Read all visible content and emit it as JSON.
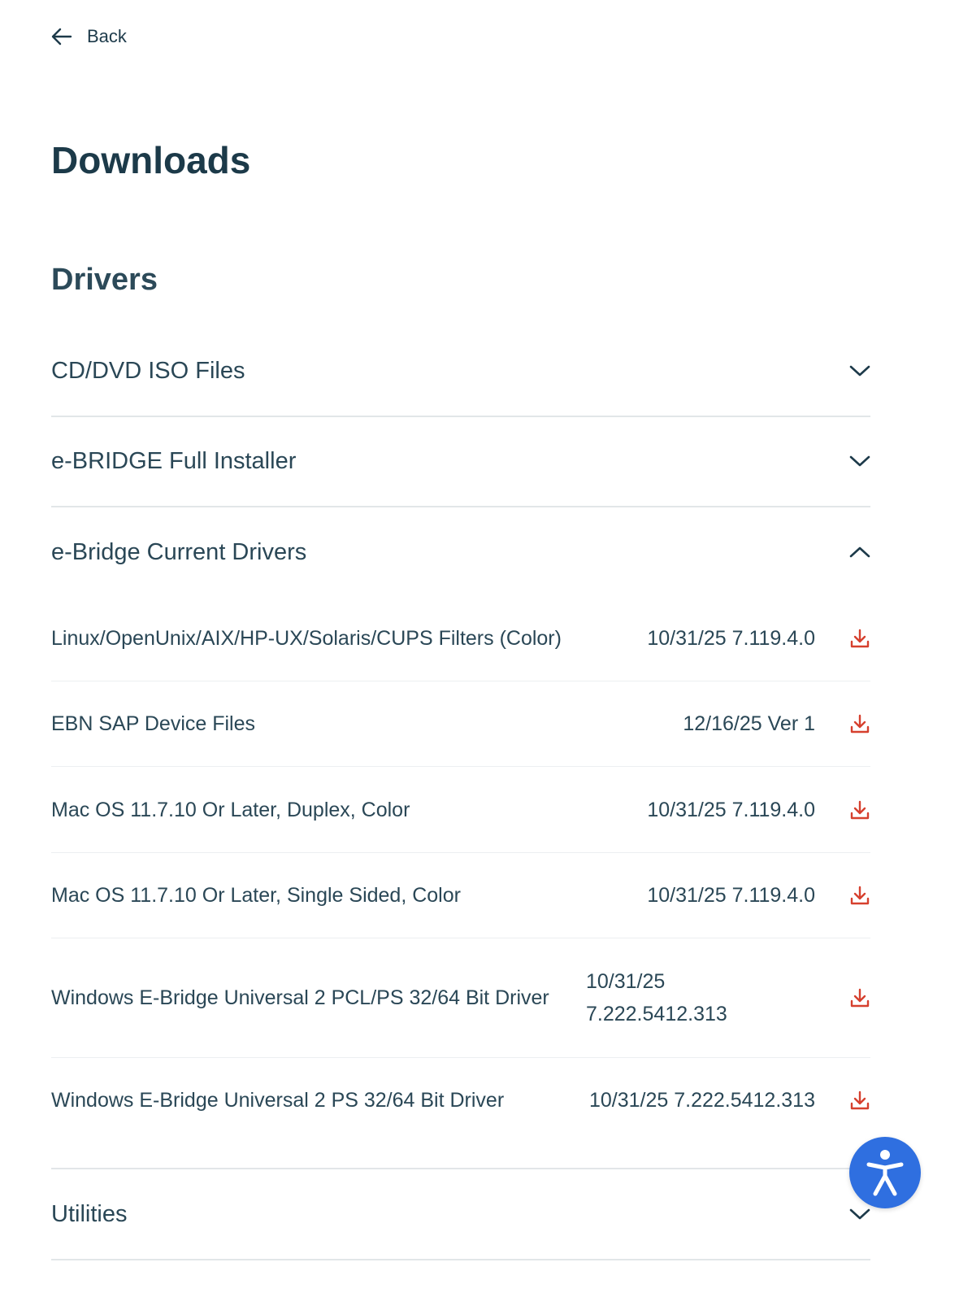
{
  "nav": {
    "back_label": "Back"
  },
  "page": {
    "title": "Downloads",
    "section_title": "Drivers"
  },
  "accordions": [
    {
      "label": "CD/DVD ISO Files",
      "expanded": false
    },
    {
      "label": "e-BRIDGE Full Installer",
      "expanded": false
    },
    {
      "label": "e-Bridge Current Drivers",
      "expanded": true
    },
    {
      "label": "Utilities",
      "expanded": false
    }
  ],
  "drivers": [
    {
      "name": "Linux/OpenUnix/AIX/HP-UX/Solaris/CUPS Filters (Color)",
      "date": "10/31/25 7.119.4.0"
    },
    {
      "name": "EBN SAP Device Files",
      "date": "12/16/25 Ver 1"
    },
    {
      "name": "Mac OS 11.7.10 Or Later, Duplex, Color",
      "date": "10/31/25 7.119.4.0"
    },
    {
      "name": "Mac OS 11.7.10 Or Later, Single Sided, Color",
      "date": "10/31/25 7.119.4.0"
    },
    {
      "name": "Windows E-Bridge Universal 2 PCL/PS 32/64 Bit Driver",
      "date": "10/31/25 7.222.5412.313"
    },
    {
      "name": "Windows E-Bridge Universal 2 PS 32/64 Bit Driver",
      "date": "10/31/25 7.222.5412.313"
    }
  ],
  "icons": {
    "back": "arrow-left-icon",
    "collapsed": "chevron-down-icon",
    "expanded": "chevron-up-icon",
    "download": "download-icon",
    "accessibility": "accessibility-icon"
  },
  "colors": {
    "text": "#1d3a4a",
    "download_icon": "#d6402e",
    "divider": "#e2e6e8",
    "accessibility_button": "#2f6fe0"
  }
}
